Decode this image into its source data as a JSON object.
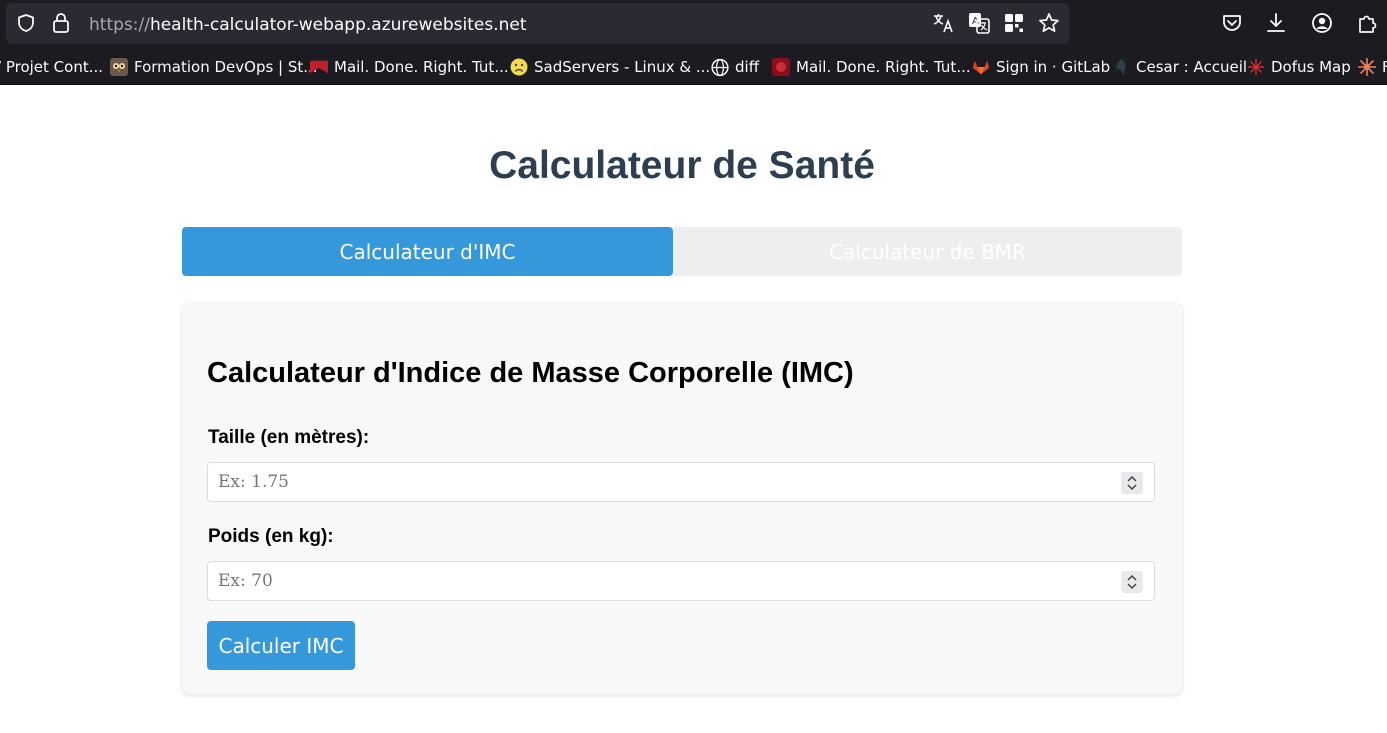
{
  "browser": {
    "url_protocol": "https://",
    "url_host": "health-calculator-webapp.azurewebsites.net",
    "address_icons": [
      "shield-icon",
      "lock-icon"
    ],
    "url_action_icons": [
      "translate-icon",
      "translate-page-icon",
      "qr-code-icon",
      "bookmark-star-icon"
    ],
    "toolbar_icons": [
      "pocket-icon",
      "download-icon",
      "account-icon",
      "extensions-icon"
    ],
    "bookmarks": [
      {
        "label": "/ Projet Cont...",
        "icon": "none"
      },
      {
        "label": "Formation DevOps | St...",
        "icon": "owl-favicon"
      },
      {
        "label": "Mail. Done. Right. Tut...",
        "icon": "red-flag-favicon"
      },
      {
        "label": "SadServers - Linux & ...",
        "icon": "sad-face-favicon"
      },
      {
        "label": "diff",
        "icon": "globe-icon"
      },
      {
        "label": "Mail. Done. Right. Tut...",
        "icon": "red-favicon"
      },
      {
        "label": "Sign in · GitLab",
        "icon": "gitlab-favicon"
      },
      {
        "label": "Cesar : Accueil",
        "icon": "cesar-favicon"
      },
      {
        "label": "Dofus Map",
        "icon": "dofus-favicon"
      },
      {
        "label": "F",
        "icon": "sun-favicon"
      }
    ]
  },
  "page": {
    "title": "Calculateur de Santé",
    "tabs": [
      {
        "label": "Calculateur d'IMC",
        "active": true
      },
      {
        "label": "Calculateur de BMR",
        "active": false
      }
    ],
    "imc_form": {
      "heading": "Calculateur d'Indice de Masse Corporelle (IMC)",
      "height_label": "Taille (en mètres):",
      "height_placeholder": "Ex: 1.75",
      "weight_label": "Poids (en kg):",
      "weight_placeholder": "Ex: 70",
      "submit_label": "Calculer IMC"
    }
  },
  "colors": {
    "accent": "#3498db",
    "title": "#2c3e50",
    "tab_inactive_bg": "#eeeeee",
    "card_bg": "#f8f8f8",
    "chrome_bg": "#1c1b22",
    "urlbar_bg": "#2b2a33"
  }
}
